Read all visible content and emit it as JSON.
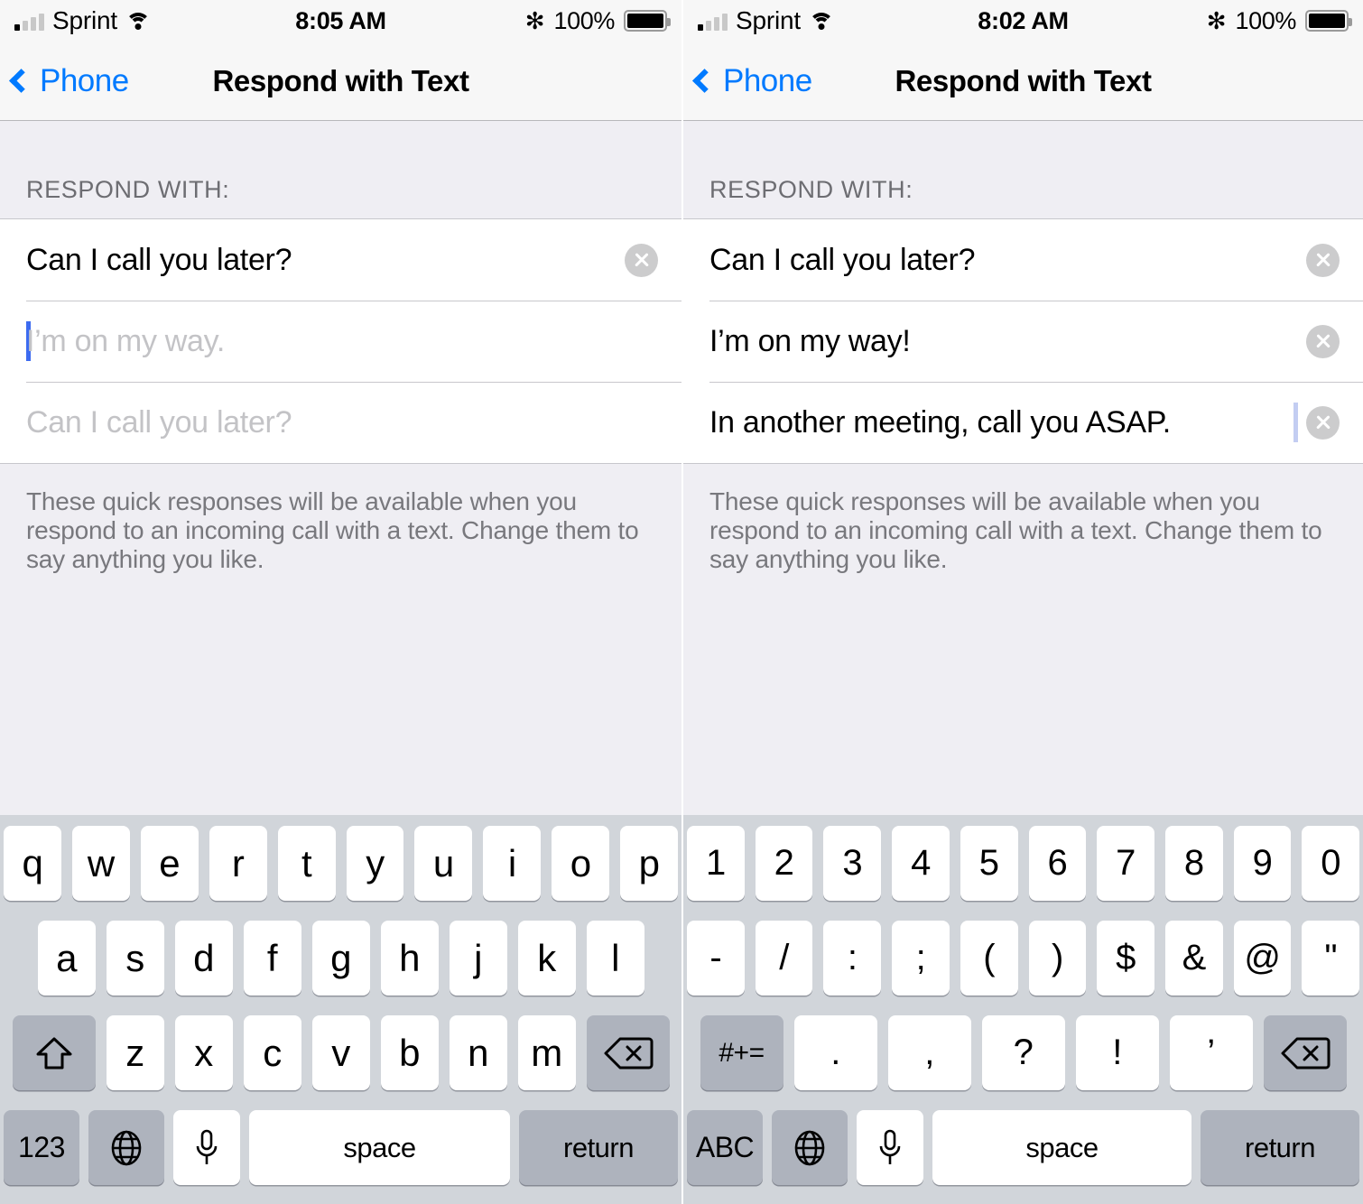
{
  "panels": [
    {
      "status": {
        "carrier": "Sprint",
        "time": "8:05 AM",
        "battery_pct": "100%",
        "signal_icon": "signal-bars-icon",
        "wifi_icon": "wifi-icon",
        "bluetooth_icon": "bluetooth-icon",
        "bluetooth_glyph": "✻"
      },
      "nav": {
        "back_label": "Phone",
        "title": "Respond with Text"
      },
      "section_header": "RESPOND WITH:",
      "rows": [
        {
          "text": "Can I call you later?",
          "placeholder": false,
          "clear": true,
          "caret": "none"
        },
        {
          "text": "I’m on my way.",
          "placeholder": true,
          "clear": false,
          "caret": "leading"
        },
        {
          "text": "Can I call you later?",
          "placeholder": true,
          "clear": false,
          "caret": "none"
        }
      ],
      "footnote": "These quick responses will be available when you respond to an incoming call with a text. Change them to say anything you like.",
      "keyboard": {
        "type": "letters",
        "row1": [
          "q",
          "w",
          "e",
          "r",
          "t",
          "y",
          "u",
          "i",
          "o",
          "p"
        ],
        "row2": [
          "a",
          "s",
          "d",
          "f",
          "g",
          "h",
          "j",
          "k",
          "l"
        ],
        "row3": [
          "z",
          "x",
          "c",
          "v",
          "b",
          "n",
          "m"
        ],
        "shift_icon": "shift-icon",
        "delete_icon": "delete-icon",
        "mode_label": "123",
        "globe_icon": "globe-icon",
        "mic_icon": "microphone-icon",
        "space_label": "space",
        "return_label": "return"
      }
    },
    {
      "status": {
        "carrier": "Sprint",
        "time": "8:02 AM",
        "battery_pct": "100%",
        "signal_icon": "signal-bars-icon",
        "wifi_icon": "wifi-icon",
        "bluetooth_icon": "bluetooth-icon",
        "bluetooth_glyph": "✻"
      },
      "nav": {
        "back_label": "Phone",
        "title": "Respond with Text"
      },
      "section_header": "RESPOND WITH:",
      "rows": [
        {
          "text": "Can I call you later?",
          "placeholder": false,
          "clear": true,
          "caret": "none"
        },
        {
          "text": "I’m on my way!",
          "placeholder": false,
          "clear": true,
          "caret": "none"
        },
        {
          "text": "In another meeting, call you ASAP.",
          "placeholder": false,
          "clear": true,
          "caret": "trailing-faint"
        }
      ],
      "footnote": "These quick responses will be available when you respond to an incoming call with a text. Change them to say anything you like.",
      "keyboard": {
        "type": "numbers",
        "row1": [
          "1",
          "2",
          "3",
          "4",
          "5",
          "6",
          "7",
          "8",
          "9",
          "0"
        ],
        "row2": [
          "-",
          "/",
          ":",
          ";",
          "(",
          ")",
          "$",
          "&",
          "@",
          "\""
        ],
        "row3": [
          ".",
          ",",
          "?",
          "!",
          "’"
        ],
        "symbols_label": "#+=",
        "delete_icon": "delete-icon",
        "mode_label": "ABC",
        "globe_icon": "globe-icon",
        "mic_icon": "microphone-icon",
        "space_label": "space",
        "return_label": "return"
      }
    }
  ],
  "colors": {
    "ios_blue": "#007aff",
    "caret_blue": "#3c6bf0",
    "keyboard_bg": "#d1d5da",
    "key_dark": "#aeb3bd",
    "content_bg": "#efeef3",
    "clear_gray": "#cccccd"
  }
}
